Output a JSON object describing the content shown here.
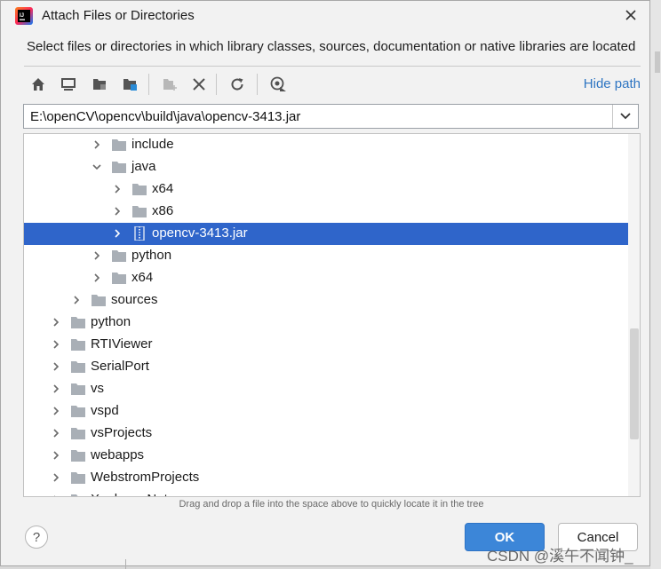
{
  "window": {
    "title": "Attach Files or Directories"
  },
  "description": "Select files or directories in which library classes, sources, documentation or native libraries are located",
  "toolbar": {
    "buttons": [
      "home-icon",
      "desktop-icon",
      "project-folder-icon",
      "module-folder-icon",
      "new-folder-icon",
      "delete-icon",
      "refresh-icon",
      "show-hidden-icon"
    ],
    "hide_path_label": "Hide path"
  },
  "path_field": {
    "value": "E:\\openCV\\opencv\\build\\java\\opencv-3413.jar"
  },
  "tree": {
    "rows": [
      {
        "label": "include",
        "expanded": false,
        "type": "folder"
      },
      {
        "label": "java",
        "expanded": true,
        "type": "folder"
      },
      {
        "label": "x64",
        "expanded": false,
        "type": "folder"
      },
      {
        "label": "x86",
        "expanded": false,
        "type": "folder"
      },
      {
        "label": "opencv-3413.jar",
        "expanded": false,
        "type": "jar",
        "selected": true
      },
      {
        "label": "python",
        "expanded": false,
        "type": "folder"
      },
      {
        "label": "x64",
        "expanded": false,
        "type": "folder"
      },
      {
        "label": "sources",
        "expanded": false,
        "type": "folder"
      },
      {
        "label": "python",
        "expanded": false,
        "type": "folder"
      },
      {
        "label": "RTIViewer",
        "expanded": false,
        "type": "folder"
      },
      {
        "label": "SerialPort",
        "expanded": false,
        "type": "folder"
      },
      {
        "label": "vs",
        "expanded": false,
        "type": "folder"
      },
      {
        "label": "vspd",
        "expanded": false,
        "type": "folder"
      },
      {
        "label": "vsProjects",
        "expanded": false,
        "type": "folder"
      },
      {
        "label": "webapps",
        "expanded": false,
        "type": "folder"
      },
      {
        "label": "WebstromProjects",
        "expanded": false,
        "type": "folder"
      },
      {
        "label": "XunleanaNet",
        "expanded": false,
        "type": "folder"
      }
    ]
  },
  "hint": "Drag and drop a file into the space above to quickly locate it in the tree",
  "buttons": {
    "help": "?",
    "ok": "OK",
    "cancel": "Cancel"
  },
  "watermark": "CSDN @溪午不闻钟_",
  "colors": {
    "selection": "#2f65ca",
    "link": "#2e75c2",
    "ok_button": "#3c86d8"
  }
}
